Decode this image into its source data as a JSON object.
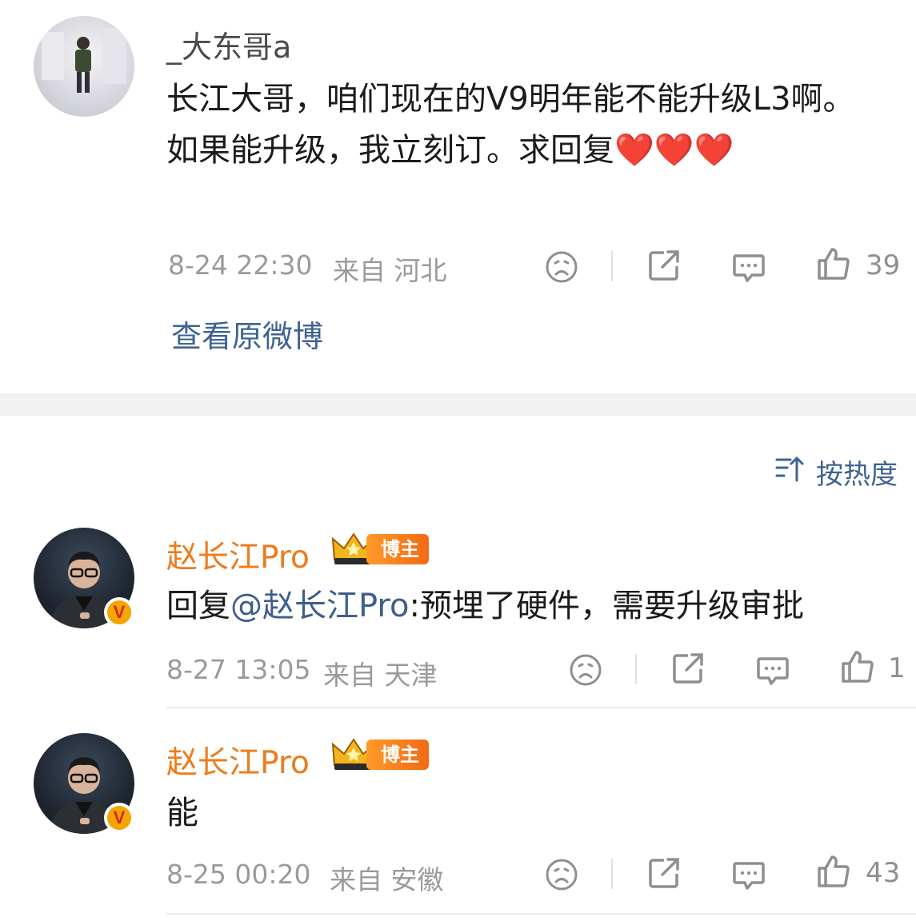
{
  "original": {
    "username": "_大东哥a",
    "text": "长江大哥，咱们现在的V9明年能不能升级L3啊。如果能升级，我立刻订。求回复❤️❤️❤️",
    "timestamp": "8-24 22:30",
    "location": "来自 河北",
    "like_count": "39",
    "view_original": "查看原微博"
  },
  "sort": {
    "label": "按热度",
    "icon": "sort-icon"
  },
  "replies": [
    {
      "username": "赵长江Pro",
      "badge": "博主",
      "reply_prefix": "回复",
      "mention": "@赵长江Pro",
      "text": ":预埋了硬件，需要升级审批",
      "timestamp": "8-27 13:05",
      "location": "来自 天津",
      "like_count": "1"
    },
    {
      "username": "赵长江Pro",
      "badge": "博主",
      "text": "能",
      "timestamp": "8-25 00:20",
      "location": "来自 安徽",
      "like_count": "43"
    }
  ],
  "colors": {
    "accent_orange": "#ee7b1a",
    "link_blue": "#3e6390",
    "meta_grey": "#9a9a9a",
    "section_gap": "#f2f2f2"
  }
}
